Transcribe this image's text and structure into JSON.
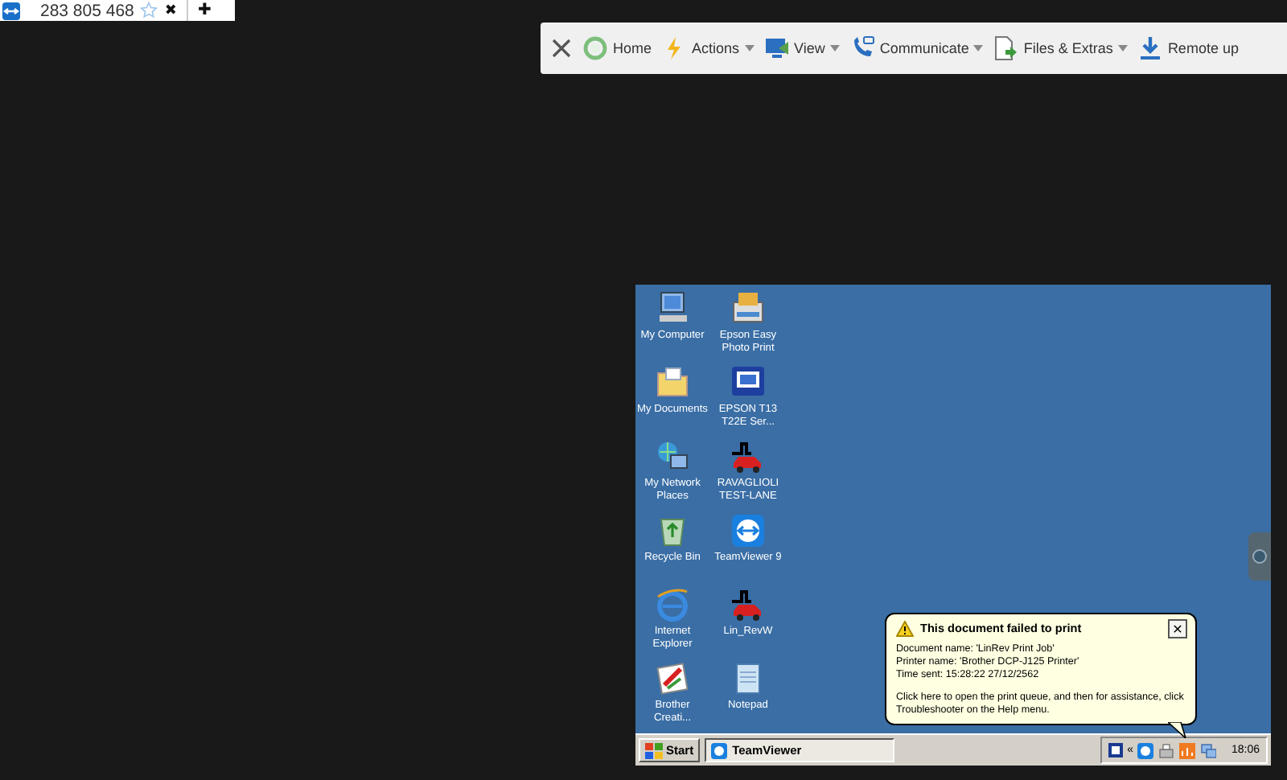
{
  "tab": {
    "title": "283 805 468",
    "close": "✖",
    "new_tab": "✚"
  },
  "toolbar": [
    {
      "kind": "close"
    },
    {
      "kind": "home",
      "label": "Home",
      "dropdown": false
    },
    {
      "kind": "actions",
      "label": "Actions",
      "dropdown": true
    },
    {
      "kind": "view",
      "label": "View",
      "dropdown": true
    },
    {
      "kind": "communicate",
      "label": "Communicate",
      "dropdown": true
    },
    {
      "kind": "files",
      "label": "Files & Extras",
      "dropdown": true
    },
    {
      "kind": "download",
      "label": "Remote up",
      "dropdown": false
    }
  ],
  "desktop": {
    "icons": [
      {
        "kind": "computer",
        "label": "My Computer"
      },
      {
        "kind": "photo",
        "label": "Epson Easy Photo Print"
      },
      {
        "kind": "folder",
        "label": "My Documents"
      },
      {
        "kind": "monitor",
        "label": "EPSON T13 T22E Ser..."
      },
      {
        "kind": "network",
        "label": "My Network Places"
      },
      {
        "kind": "car",
        "label": "RAVAGLIOLI TEST-LANE"
      },
      {
        "kind": "recycle",
        "label": "Recycle Bin"
      },
      {
        "kind": "teamviewer",
        "label": "TeamViewer 9"
      },
      {
        "kind": "ie",
        "label": "Internet Explorer"
      },
      {
        "kind": "car",
        "label": "Lin_RevW"
      },
      {
        "kind": "brother",
        "label": "Brother Creati..."
      },
      {
        "kind": "notepad",
        "label": "Notepad"
      }
    ],
    "balloon": {
      "title": "This document failed to print",
      "close": "✕",
      "lines": [
        "Document name: 'LinRev Print Job'",
        "Printer name: 'Brother DCP-J125 Printer'",
        "Time sent: 15:28:22  27/12/2562"
      ],
      "note": "Click here to open the print queue, and then for assistance, click Troubleshooter on the Help menu."
    },
    "taskbar": {
      "start": "Start",
      "tasks": [
        "TeamViewer"
      ],
      "expand": "«",
      "clock": "18:06"
    }
  }
}
